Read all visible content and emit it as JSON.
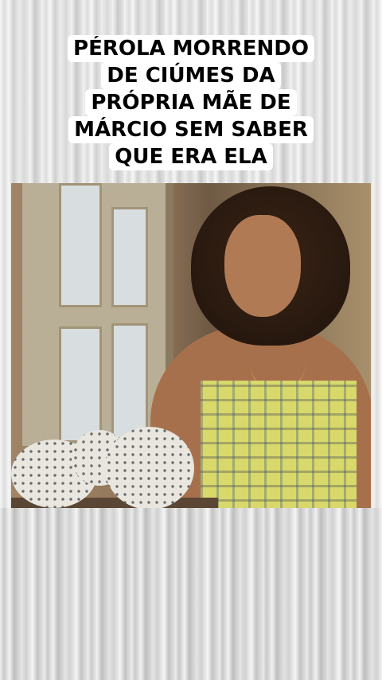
{
  "caption": {
    "lines": [
      "PÉROLA MORRENDO",
      "DE CIÚMES DA",
      "PRÓPRIA MÃE DE",
      "MÁRCIO SEM SABER",
      "QUE ERA ELA"
    ]
  }
}
